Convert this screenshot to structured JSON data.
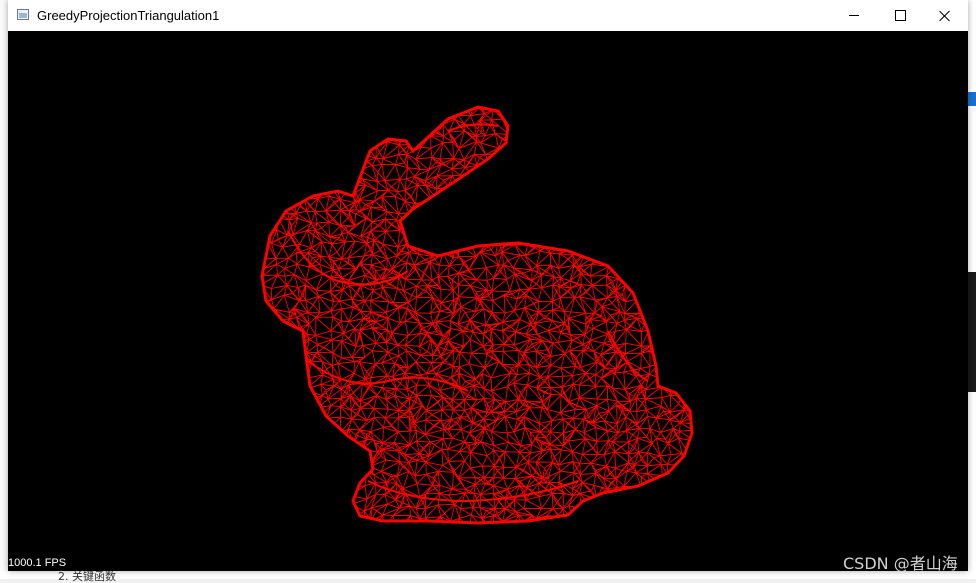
{
  "window": {
    "title": "GreedyProjectionTriangulation1",
    "icon": "app-window-icon"
  },
  "controls": {
    "minimize": "minimize-icon",
    "maximize": "maximize-icon",
    "close": "close-icon"
  },
  "viewport": {
    "background": "#000000",
    "mesh_color": "#ff0000",
    "fps_label": "1000.1 FPS",
    "watermark": "CSDN @者山海"
  },
  "background": {
    "bottom_text": "2. 关键函数"
  }
}
